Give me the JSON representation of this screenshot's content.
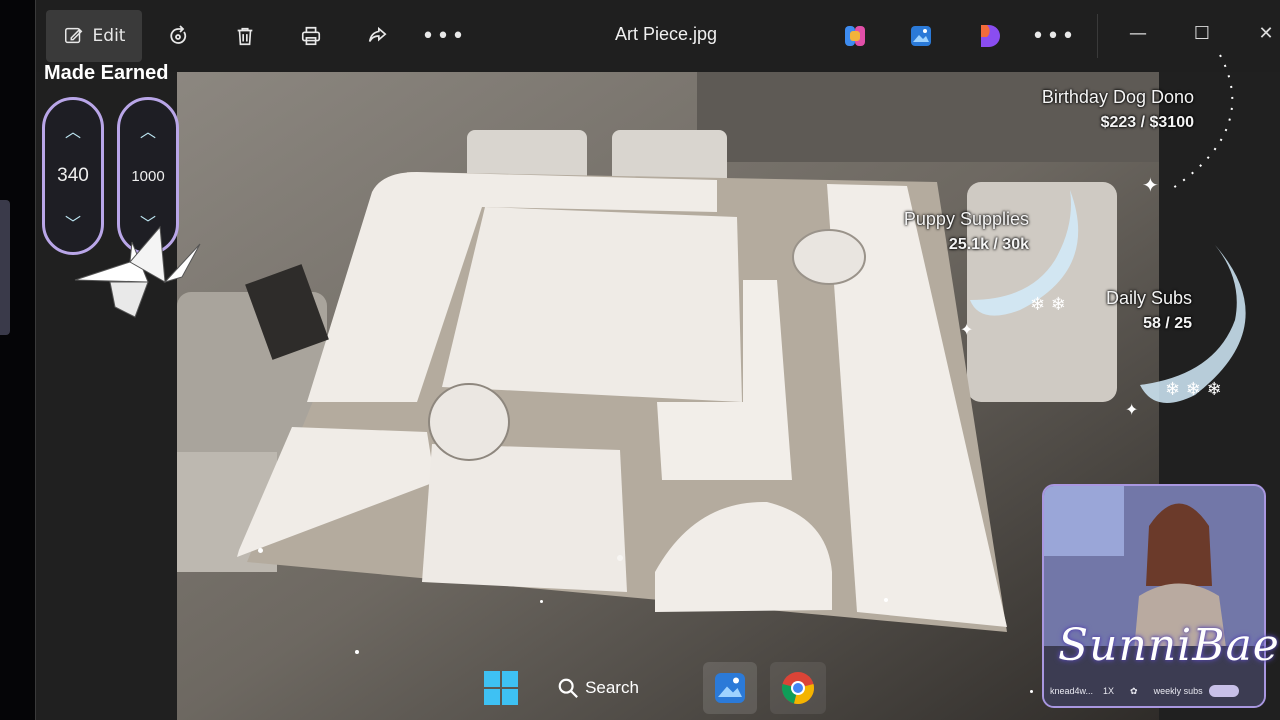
{
  "window": {
    "title": "Art Piece.jpg",
    "toolbar": {
      "edit_label": "Edit",
      "icons": [
        "edit-icon",
        "rotate-icon",
        "delete-icon",
        "print-icon",
        "share-icon",
        "more-icon"
      ],
      "app_icons": [
        "copilot-icon",
        "photos-icon",
        "designer-icon",
        "more-icon"
      ]
    },
    "controls": {
      "minimize": "—",
      "maximize": "☐",
      "close": "✕"
    }
  },
  "overlay": {
    "made_earned": {
      "title": "Made Earned",
      "made": "340",
      "earned": "1000"
    },
    "goals": [
      {
        "title": "Birthday Dog Dono",
        "value": "$223 / $3100"
      },
      {
        "title": "Puppy Supplies",
        "value": "25.1k / 30k"
      },
      {
        "title": "Daily Subs",
        "value": "58 / 25"
      }
    ],
    "webcam": {
      "brand": "SunniBae",
      "user": "knead4w...",
      "multiplier": "1X",
      "label": "weekly subs"
    }
  },
  "taskbar": {
    "search_label": "Search",
    "icons": [
      "windows-start-icon",
      "search-icon",
      "photos-icon",
      "chrome-icon"
    ]
  },
  "colors": {
    "accent": "#b9a6e8",
    "titlebar": "#1f1f1f",
    "window_bg": "#202020"
  }
}
